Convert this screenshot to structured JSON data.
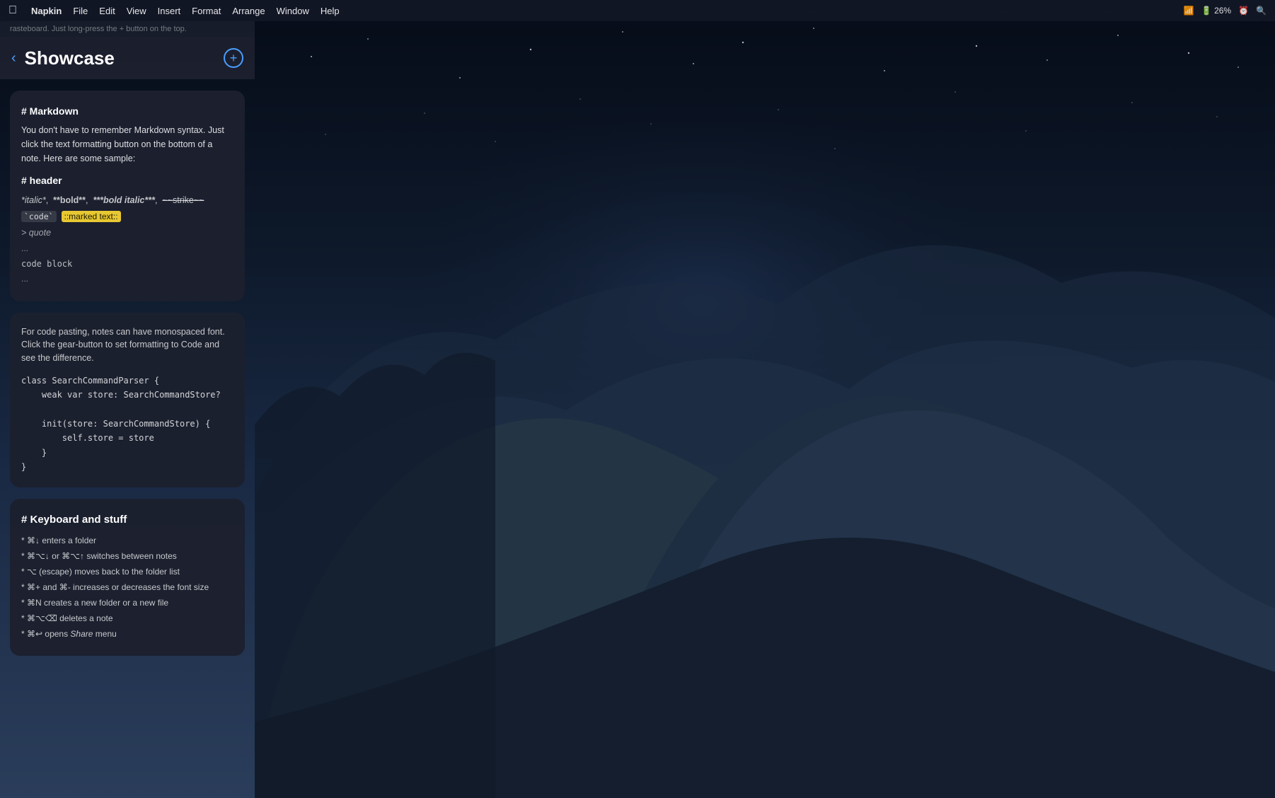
{
  "menubar": {
    "apple": "⌘",
    "items": [
      "Napkin",
      "File",
      "Edit",
      "View",
      "Insert",
      "Format",
      "Arrange",
      "Window",
      "Help"
    ],
    "hint": "rasteboard. Just long-press the + button on the top."
  },
  "header": {
    "back_label": "‹",
    "title": "Showcase",
    "add_label": "+"
  },
  "note1": {
    "heading": "# Markdown",
    "body": "You don't have to remember Markdown syntax. Just click the text formatting button on the bottom of a note. Here are some sample:",
    "section_header": "# header",
    "inline_line_prefix": "*italic*",
    "inline_bold": "**bold**",
    "inline_bold_italic": "***bold italic***",
    "inline_strike": "~~strike~~",
    "code_label": "`code`",
    "marked_text": "::marked text::",
    "quote": "> quote",
    "dots1": "...",
    "codeblock": "code block",
    "dots2": "..."
  },
  "note2": {
    "desc_line1": "For code pasting, notes can have monospaced font.",
    "desc_line2": "Click the gear-button to set formatting to Code and",
    "desc_line3": "see the difference.",
    "code": "class SearchCommandParser {\n    weak var store: SearchCommandStore?\n\n    init(store: SearchCommandStore) {\n        self.store = store\n    }\n}"
  },
  "note3": {
    "heading": "# Keyboard and stuff",
    "items": [
      "* ⌘↓ enters a folder",
      "* ⌘⌥↓ or ⌘⌥↑ switches between notes",
      "* ⌥ (escape) moves back to the folder list",
      "* ⌘+ and ⌘- increases or decreases the font size",
      "* ⌘N creates a new folder or a new file",
      "* ⌘⌥⌫ deletes a note",
      "* ⌘↩ opens *Share* menu"
    ]
  },
  "status_bar": {
    "battery": "26%",
    "time": "..."
  }
}
